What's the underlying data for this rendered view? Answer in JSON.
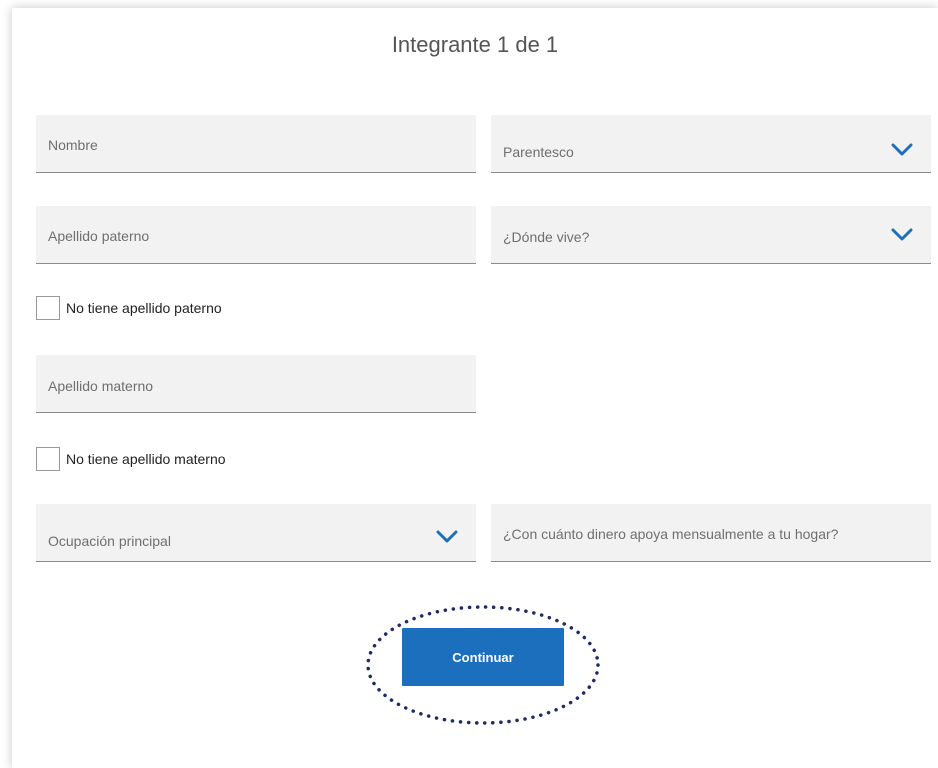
{
  "form": {
    "title": "Integrante 1 de 1",
    "fields": {
      "nombre": {
        "placeholder": "Nombre"
      },
      "parentesco": {
        "placeholder": "Parentesco",
        "icon": "chevron-down-icon"
      },
      "apellido_paterno": {
        "placeholder": "Apellido paterno"
      },
      "donde_vive": {
        "placeholder": "¿Dónde vive?",
        "icon": "chevron-down-icon"
      },
      "apellido_materno": {
        "placeholder": "Apellido materno"
      },
      "ocupacion": {
        "placeholder": "Ocupación principal",
        "icon": "chevron-down-icon"
      },
      "dinero": {
        "placeholder": "¿Con cuánto dinero apoya mensualmente a tu hogar?"
      }
    },
    "checkboxes": {
      "no_paterno": {
        "label": "No tiene apellido paterno",
        "checked": false
      },
      "no_materno": {
        "label": "No tiene apellido materno",
        "checked": false
      }
    },
    "submit_label": "Continuar"
  },
  "colors": {
    "accent": "#1b6fbd",
    "field_bg": "#f2f2f2",
    "highlight_ring": "#1f2a66"
  }
}
